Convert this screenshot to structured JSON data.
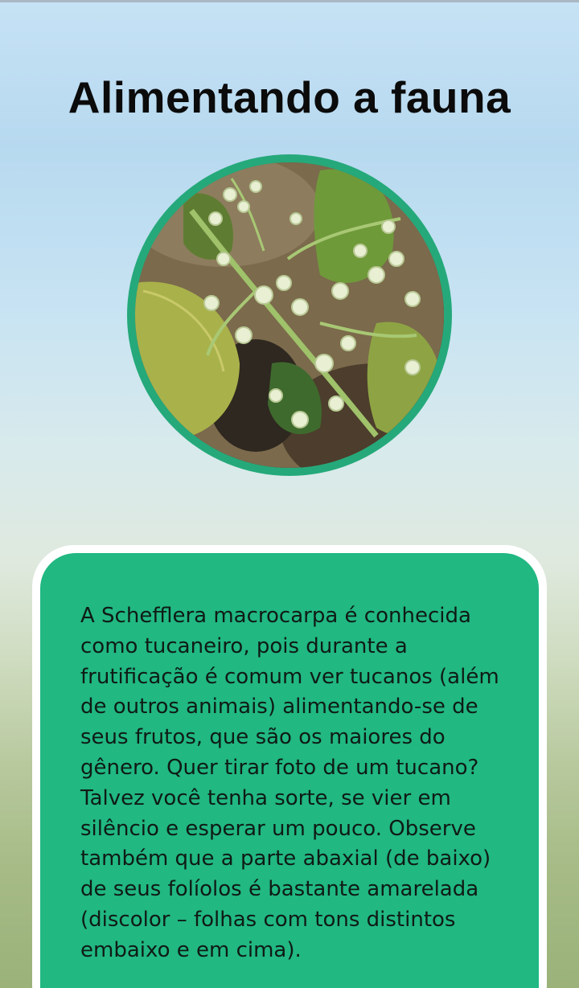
{
  "page": {
    "title": "Alimentando a fauna"
  },
  "photo": {
    "subject": "Schefflera macrocarpa flowers and fruit buds",
    "ring_color": "#25a97a"
  },
  "info_card": {
    "background_color": "#21b882",
    "text": "A Schefflera macrocarpa é conhecida como tucaneiro, pois durante a frutificação é comum ver tucanos (além de outros animais) alimentando-se de seus frutos, que são os maiores do gênero. Quer tirar foto de um tucano? Talvez você tenha sorte, se vier em silêncio e esperar um pouco.  Observe também que a parte abaxial (de baixo) de seus folíolos é bastante amarelada (discolor – folhas com tons distintos embaixo e em cima)."
  }
}
